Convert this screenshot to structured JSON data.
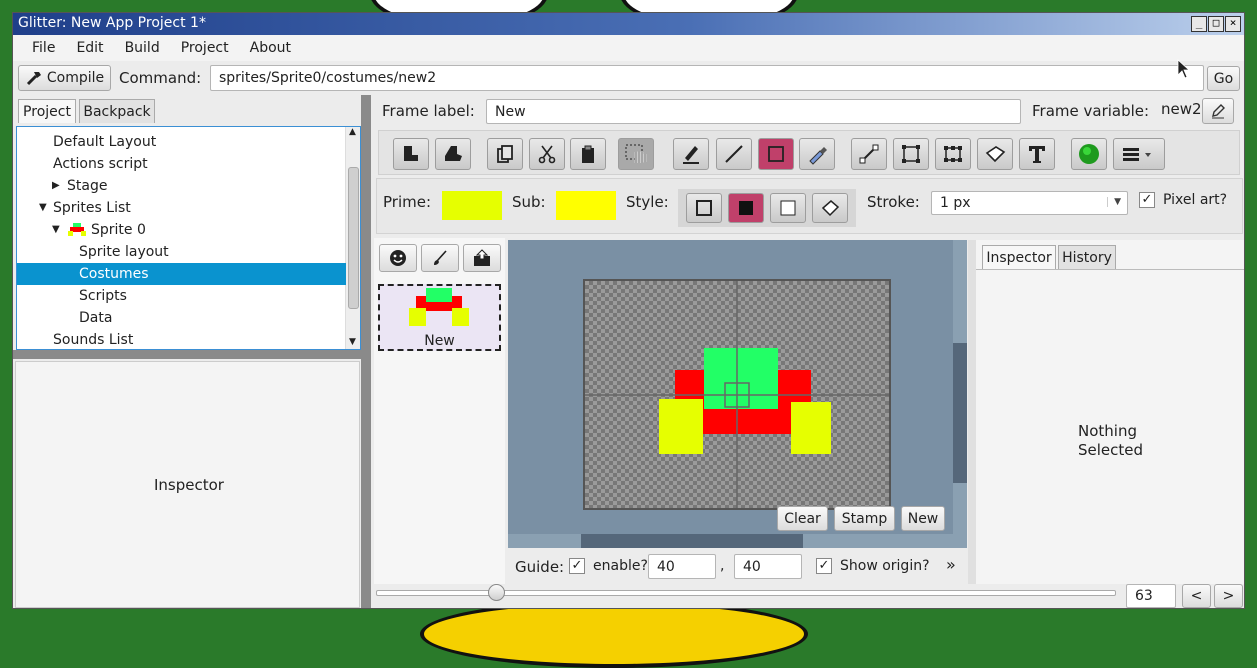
{
  "window": {
    "title": "Glitter: New App Project 1*",
    "min": "_",
    "max": "□",
    "close": "×"
  },
  "menu": [
    "File",
    "Edit",
    "Build",
    "Project",
    "About"
  ],
  "command_bar": {
    "compile_label": "Compile",
    "command_label": "Command:",
    "command_value": "sprites/Sprite0/costumes/new2",
    "go_label": "Go"
  },
  "left_tabs": [
    "Project",
    "Backpack"
  ],
  "tree": {
    "items": [
      {
        "label": "Default Layout",
        "indent": 1
      },
      {
        "label": "Actions script",
        "indent": 1
      },
      {
        "label": "Stage",
        "indent": 2,
        "arrow": "▶"
      },
      {
        "label": "Sprites List",
        "indent": 1,
        "arrow": "▼"
      },
      {
        "label": "Sprite 0",
        "indent": 2,
        "arrow": "▼",
        "icon": "sprite-thumb-icon"
      },
      {
        "label": "Sprite layout",
        "indent": 3
      },
      {
        "label": "Costumes",
        "indent": 3,
        "selected": true
      },
      {
        "label": "Scripts",
        "indent": 3
      },
      {
        "label": "Data",
        "indent": 3
      },
      {
        "label": "Sounds List",
        "indent": 1
      }
    ]
  },
  "left_inspector": {
    "label": "Inspector"
  },
  "frame": {
    "label_text": "Frame label:",
    "label_value": "New",
    "variable_text": "Frame variable:",
    "variable_value": "new2"
  },
  "toolbar_icons": [
    "fill-icon",
    "fill-alt-icon",
    "copy-icon",
    "cut-icon",
    "paste-icon",
    "select-hand-icon",
    "pencil-icon",
    "line-icon",
    "rectangle-icon",
    "eyedropper-icon",
    "segment-icon",
    "marquee-icon",
    "transform-icon",
    "eraser-icon",
    "text-icon",
    "color-ball-icon",
    "menu-icon"
  ],
  "colors": {
    "prime": "#e6ff00",
    "sub": "#ffff00",
    "red": "#ff0000",
    "green": "#22ff66",
    "yellow": "#e6ff00",
    "canvas_bg": "#7a90a4",
    "selection": "#0a93cf",
    "accent": "#c0406a"
  },
  "paint_props": {
    "prime_label": "Prime:",
    "sub_label": "Sub:",
    "style_label": "Style:",
    "stroke_label": "Stroke:",
    "stroke_value": "1 px",
    "pixel_art_label": "Pixel art?",
    "pixel_art_checked": true
  },
  "costume": {
    "name": "New"
  },
  "canvas_buttons": {
    "clear": "Clear",
    "stamp": "Stamp",
    "new": "New"
  },
  "guide": {
    "label": "Guide:",
    "enable_label": "enable?",
    "enable_checked": true,
    "x": "40",
    "comma": ",",
    "y": "40",
    "origin_label": "Show origin?",
    "origin_checked": true,
    "more": "»"
  },
  "right_tabs": [
    "Inspector",
    "History"
  ],
  "right_inspector": {
    "line1": "Nothing",
    "line2": "Selected"
  },
  "bottom": {
    "zoom_value": "63",
    "prev": "<",
    "next": ">"
  }
}
